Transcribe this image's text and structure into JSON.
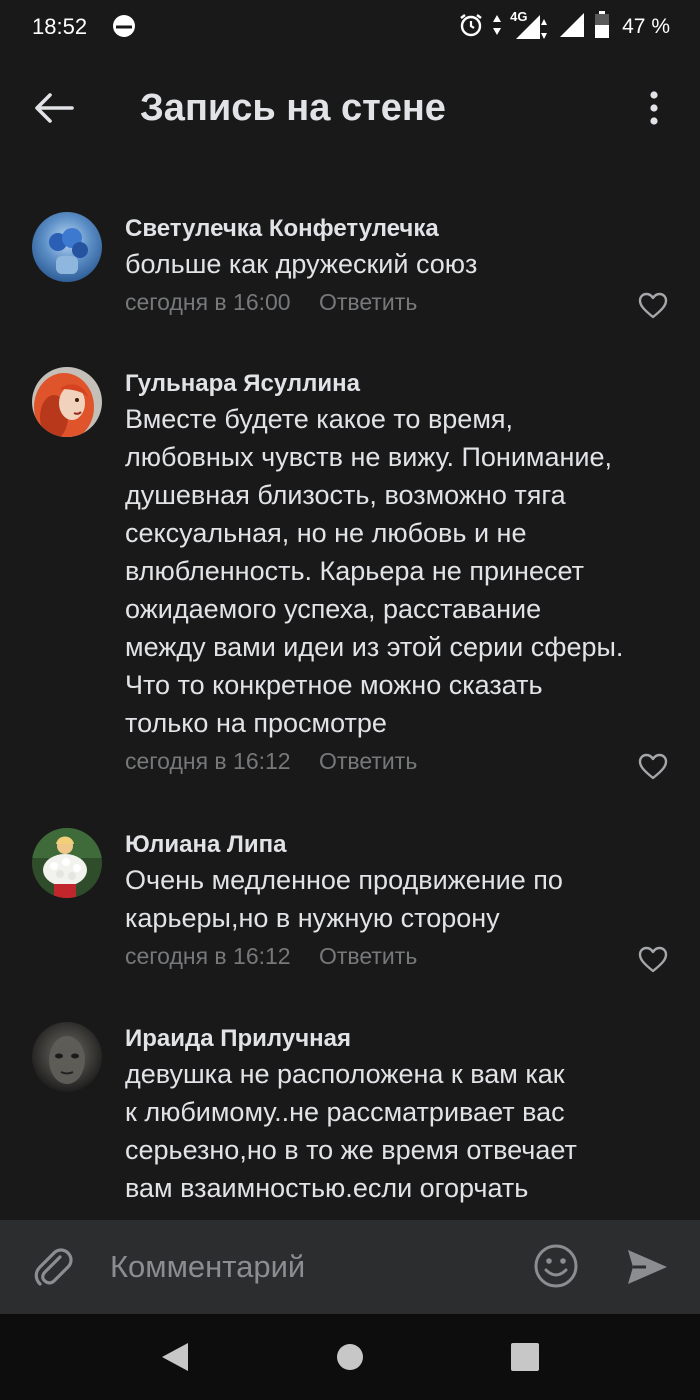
{
  "status_bar": {
    "time": "18:52",
    "network": "4G",
    "battery": "47 %"
  },
  "header": {
    "title": "Запись на стене",
    "back_icon": "arrow-left-icon",
    "menu_icon": "more-vertical-icon"
  },
  "comments": [
    {
      "author": "Светулечка Конфетулечка",
      "text": "больше как дружеский союз",
      "time": "сегодня в 16:00",
      "reply": "Ответить",
      "avatar_colors": [
        "#5d8fc7",
        "#2f5f98"
      ]
    },
    {
      "author": "Гульнара Ясуллина",
      "text": "Вместе будете какое то время,\nлюбовных чувств не вижу. Понимание,\nдушевная близость, возможно тяга\nсексуальная, но не любовь и не\nвлюбленность. Карьера не принесет\nожидаемого успеха, расставание\nмежду вами идеи из этой серии сферы.\nЧто то конкретное можно сказать\nтолько на просмотре",
      "time": "сегодня в 16:12",
      "reply": "Ответить",
      "avatar_colors": [
        "#e0542c",
        "#8a2a18"
      ]
    },
    {
      "author": "Юлиана Липа",
      "text": "Очень медленное продвижение по\nкарьеры,но в  нужную сторону",
      "time": "сегодня в 16:12",
      "reply": "Ответить",
      "avatar_colors": [
        "#3f6b3a",
        "#e8e8e8"
      ]
    },
    {
      "author": "Ираида Прилучная",
      "text": "девушка не расположена к вам как\nк любимому..не рассматривает вас\nсерьезно,но в то же время отвечает\nвам взаимностью.если огорчать",
      "avatar_colors": [
        "#4a4a48",
        "#1c1c1c"
      ]
    }
  ],
  "composer": {
    "placeholder": "Комментарий"
  },
  "colors": {
    "background": "#19191a",
    "composer_bg": "#2c2d2e",
    "text_primary": "#e1e3e6",
    "text_secondary": "#76787a"
  }
}
